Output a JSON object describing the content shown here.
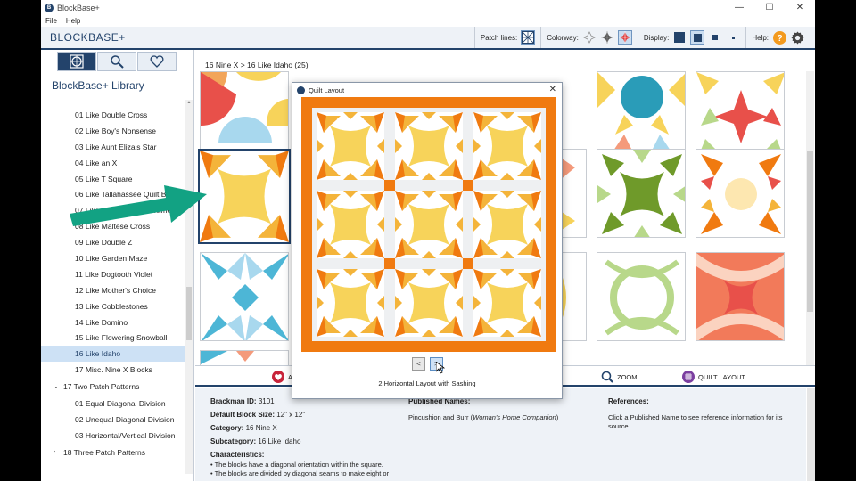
{
  "window": {
    "title": "BlockBase+",
    "controls": [
      "—",
      "☐",
      "✕"
    ]
  },
  "menu": {
    "items": [
      "File",
      "Help"
    ]
  },
  "toolbar": {
    "app_title": "BLOCKBASE+",
    "patch_lines_label": "Patch lines:",
    "colorway_label": "Colorway:",
    "display_label": "Display:",
    "help_label": "Help:"
  },
  "sidebar": {
    "tabs": [
      "block-tab",
      "search-tab",
      "favorites-tab"
    ],
    "library_title": "BlockBase+ Library",
    "items": [
      "01 Like Double Cross",
      "02 Like Boy's Nonsense",
      "03 Like Aunt Eliza's Star",
      "04 Like an X",
      "05 Like T Square",
      "06 Like Tallahassee Quilt Block",
      "07 Like Garden Maze Frame",
      "08 Like Maltese Cross",
      "09 Like Double Z",
      "10 Like Garden Maze",
      "11 Like Dogtooth Violet",
      "12 Like Mother's Choice",
      "13 Like Cobblestones",
      "14 Like Domino",
      "15 Like Flowering Snowball",
      "16 Like Idaho",
      "17 Misc. Nine X Blocks"
    ],
    "selected_index": 15,
    "group_17": "17 Two Patch Patterns",
    "group_17_items": [
      "01 Equal Diagonal Division",
      "02 Unequal Diagonal Division",
      "03 Horizontal/Vertical Division"
    ],
    "group_18": "18 Three Patch Patterns"
  },
  "main": {
    "breadcrumb": "16 Nine X > 16 Like Idaho (25)"
  },
  "actions": {
    "add_label": "A",
    "zoom_label": "ZOOM",
    "quilt_layout_label": "QUILT LAYOUT"
  },
  "details": {
    "brackman_id_label": "Brackman ID:",
    "brackman_id": "3101",
    "block_size_label": "Default Block Size:",
    "block_size": "12\" x 12\"",
    "category_label": "Category:",
    "category": "16 Nine X",
    "subcategory_label": "Subcategory:",
    "subcategory": "16 Like Idaho",
    "characteristics_label": "Characteristics:",
    "characteristics": [
      "• The blocks have a diagonal orientation within the square.",
      "• The blocks are divided by diagonal seams to make eight or"
    ],
    "published_names_label": "Published Names:",
    "published_name_main": "Pincushion and Burr (",
    "published_name_source": "Woman's Home Companion",
    "published_name_end": ")",
    "references_label": "References:",
    "references_text": "Click a Published Name to see reference information for its source."
  },
  "dialog": {
    "title": "Quilt Layout",
    "close": "✕",
    "prev_label": "<",
    "next_label": ">",
    "caption": "2 Horizontal Layout with Sashing"
  },
  "colors": {
    "navy": "#23436b",
    "orange": "#f07a10",
    "yellow": "#f7d35a",
    "gold": "#f4b43a",
    "teal_arrow": "#12a283",
    "help_orange": "#f39a1e"
  }
}
